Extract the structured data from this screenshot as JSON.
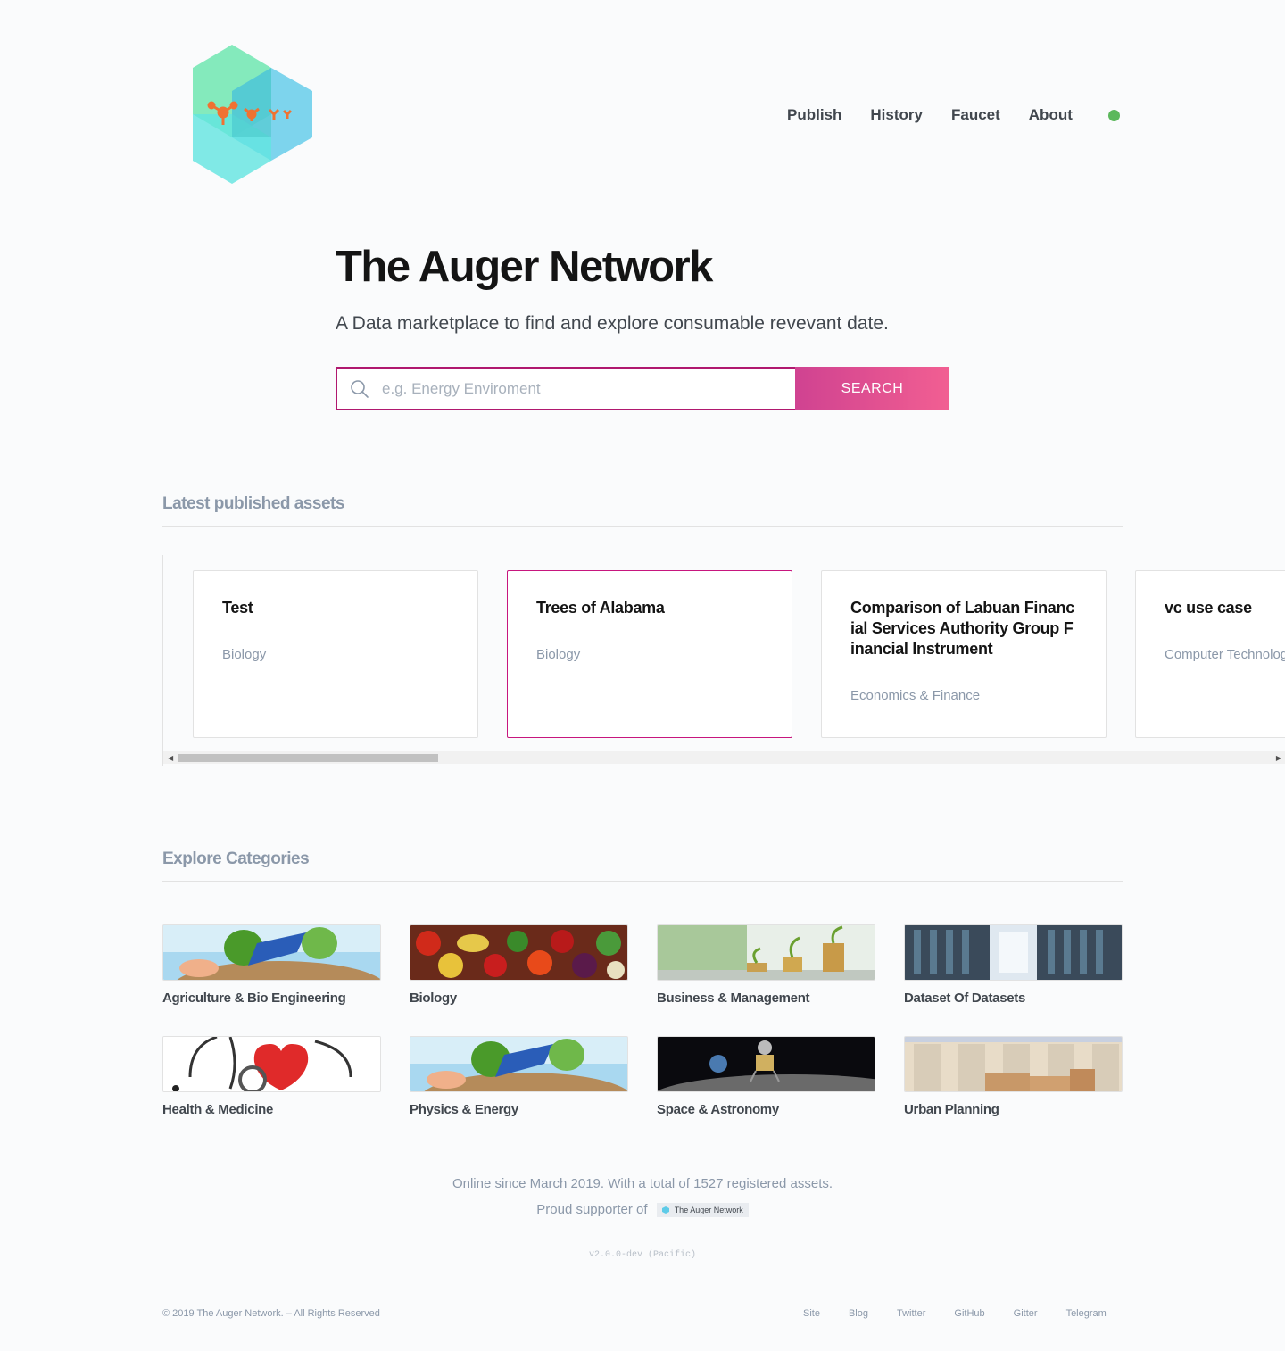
{
  "nav": {
    "publish": "Publish",
    "history": "History",
    "faucet": "Faucet",
    "about": "About",
    "status_color": "#5cb85c"
  },
  "hero": {
    "title": "The Auger Network",
    "subtitle": "A Data marketplace to find and explore consumable revevant date."
  },
  "search": {
    "placeholder": "e.g. Energy Enviroment",
    "button": "SEARCH",
    "icon": "search-icon"
  },
  "latest": {
    "title": "Latest published assets",
    "cards": [
      {
        "title": "Test",
        "category": "Biology"
      },
      {
        "title": "Trees of Alabama",
        "category": "Biology"
      },
      {
        "title": "Comparison of Labuan Financial Services Authority Group Financial Instrument",
        "category": "Economics & Finance"
      },
      {
        "title": "vc use case",
        "category": "Computer Technology"
      }
    ]
  },
  "categories": {
    "title": "Explore Categories",
    "items": [
      {
        "label": "Agriculture & Bio Engineering",
        "image": "solar-panel-tree-image"
      },
      {
        "label": "Biology",
        "image": "vegetables-image"
      },
      {
        "label": "Business & Management",
        "image": "coins-plants-image"
      },
      {
        "label": "Dataset Of Datasets",
        "image": "server-room-image"
      },
      {
        "label": "Health & Medicine",
        "image": "stethoscope-heart-image"
      },
      {
        "label": "Physics & Energy",
        "image": "solar-panel-tree-image"
      },
      {
        "label": "Space & Astronomy",
        "image": "moon-lander-image"
      },
      {
        "label": "Urban Planning",
        "image": "warehouse-boxes-image"
      }
    ]
  },
  "footer": {
    "online": "Online since March 2019. With a total of 1527 registered assets.",
    "supporter": "Proud supporter of",
    "badge": "The Auger Network",
    "version": "v2.0.0-dev (Pacific)",
    "copyright": "© 2019 The Auger Network. – All Rights Reserved",
    "links": [
      "Site",
      "Blog",
      "Twitter",
      "GitHub",
      "Gitter",
      "Telegram"
    ]
  },
  "colors": {
    "accent": "#c7167e",
    "search_gradient_start": "#c9237f",
    "search_gradient_end": "#f0437f",
    "heading_muted": "#8b98a9"
  }
}
